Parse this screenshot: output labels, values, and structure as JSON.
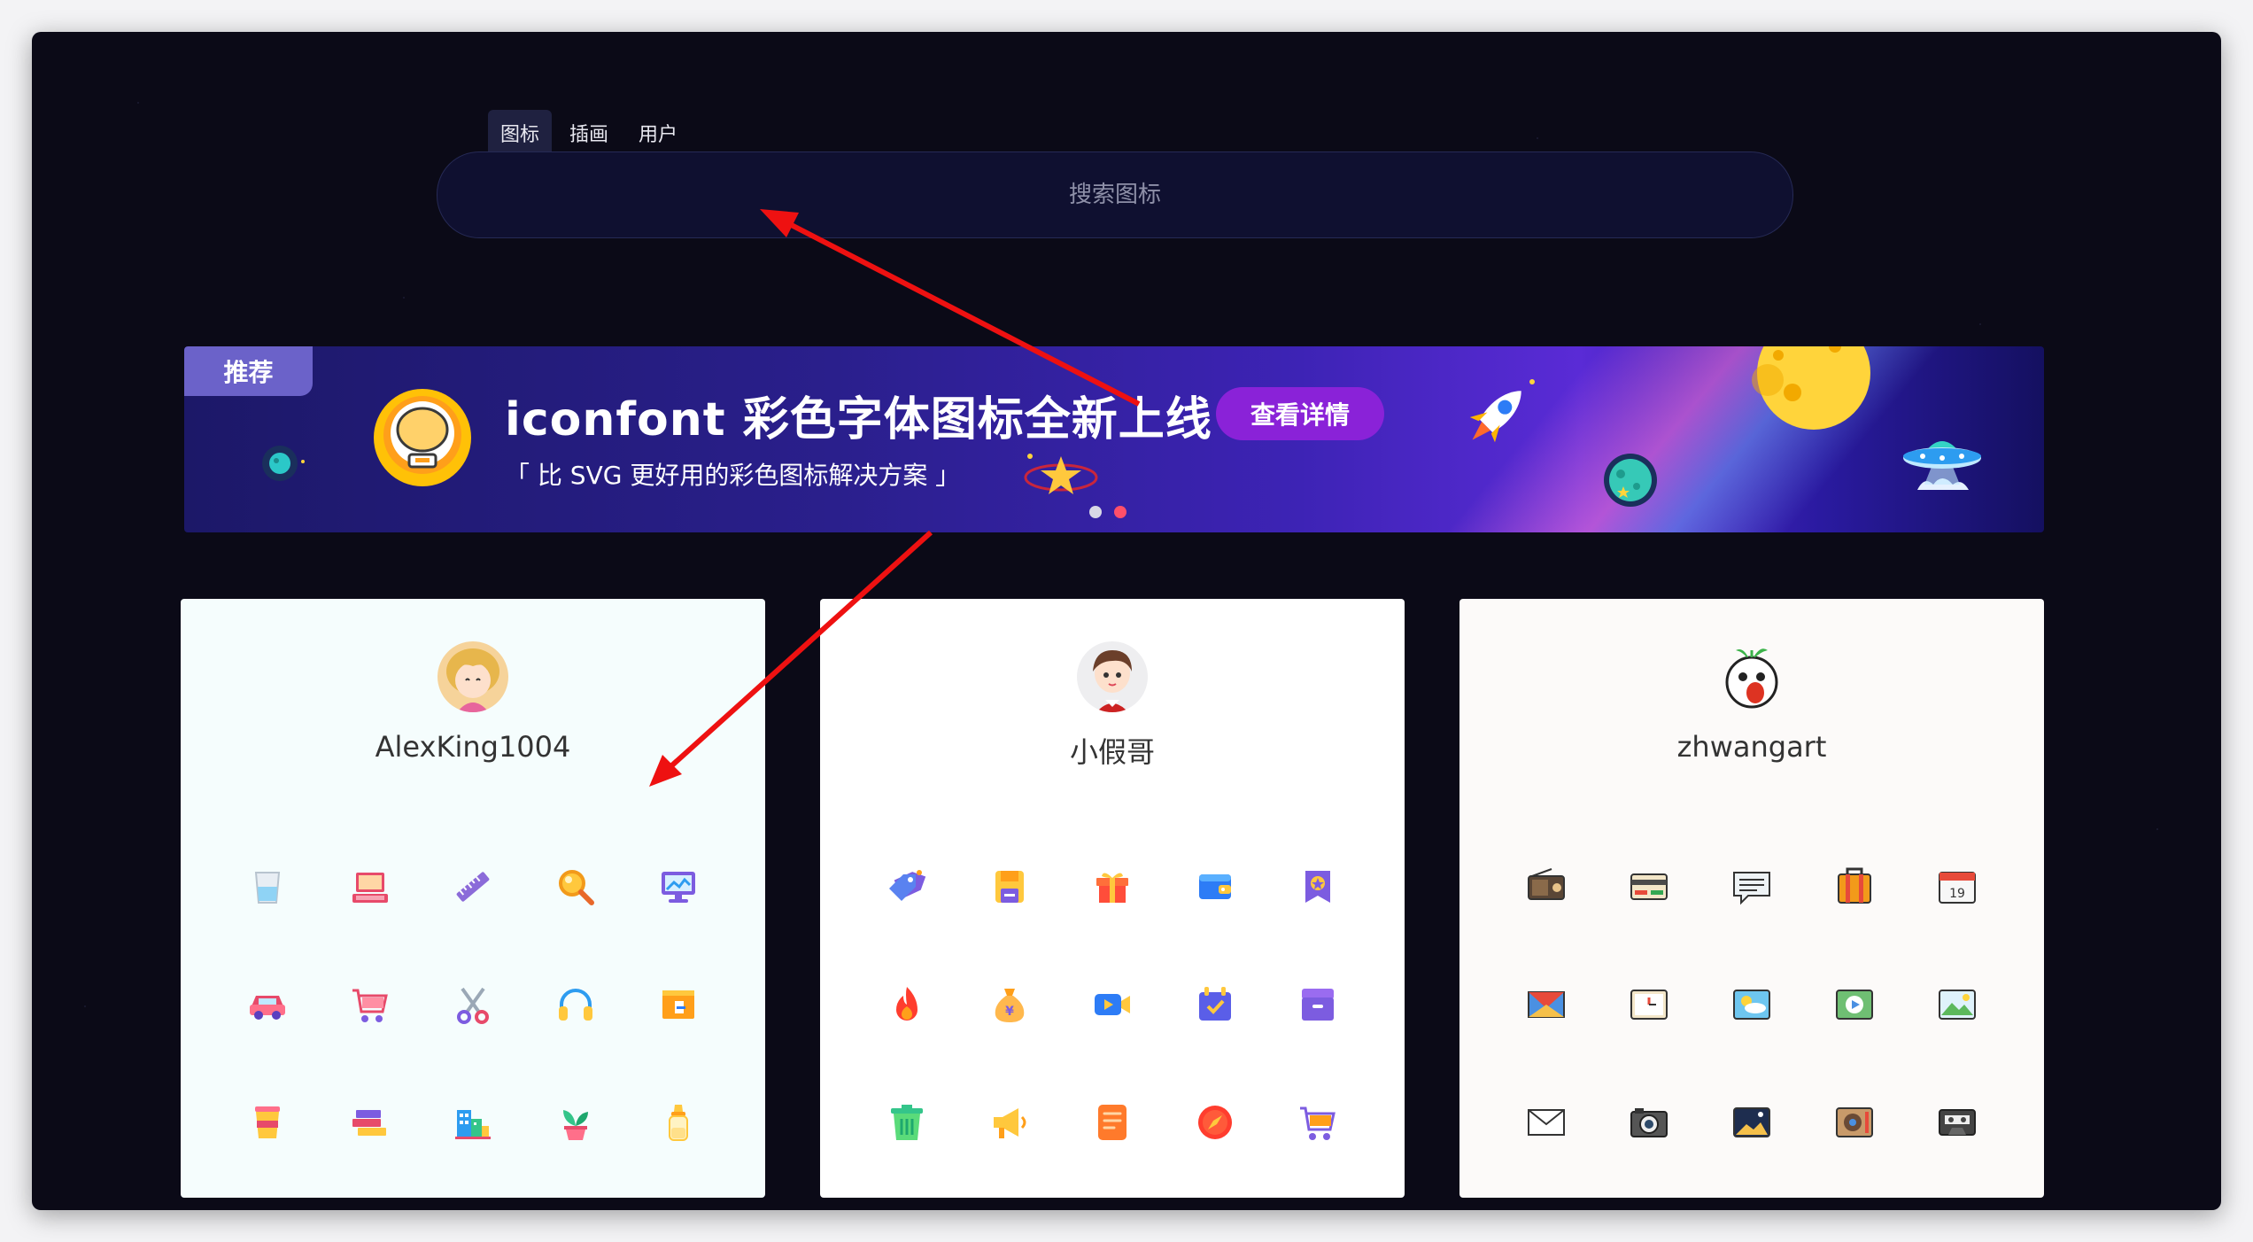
{
  "tabs": [
    {
      "label": "图标",
      "active": true
    },
    {
      "label": "插画",
      "active": false
    },
    {
      "label": "用户",
      "active": false
    }
  ],
  "search": {
    "placeholder": "搜索图标"
  },
  "banner": {
    "tag": "推荐",
    "title": "iconfont 彩色字体图标全新上线",
    "subtitle": "「 比 SVG 更好用的彩色图标解决方案 」",
    "button": "查看详情",
    "dots": 2,
    "active_dot": 1
  },
  "colors": {
    "page_bg": "#0b0a17",
    "accent": "#8a22d8",
    "annotation_arrow": "#ee1111"
  },
  "cards": [
    {
      "username": "AlexKing1004",
      "background": "#f5fdfd",
      "avatar_icon": "girl-avatar-icon",
      "icons": [
        "glass-cup-icon",
        "laptop-icon",
        "ruler-icon",
        "magnifier-icon",
        "monitor-icon",
        "car-icon",
        "shopping-cart-icon",
        "scissors-icon",
        "headphones-icon",
        "drawer-box-icon",
        "coffee-cup-icon",
        "books-icon",
        "city-buildings-icon",
        "potted-plant-icon",
        "baby-bottle-icon"
      ]
    },
    {
      "username": "小假哥",
      "background": "#ffffff",
      "avatar_icon": "boy-avatar-icon",
      "icons": [
        "price-tag-icon",
        "save-disk-icon",
        "gift-icon",
        "wallet-icon",
        "badge-bookmark-icon",
        "fire-icon",
        "money-bag-icon",
        "video-camera-icon",
        "calendar-check-icon",
        "inbox-icon",
        "trash-bin-icon",
        "megaphone-icon",
        "document-icon",
        "compass-icon",
        "cart-icon"
      ]
    },
    {
      "username": "zhwangart",
      "background": "#fcfaf9",
      "avatar_icon": "meme-face-avatar-icon",
      "icons": [
        "radio-icon",
        "credit-card-icon",
        "chat-bubble-icon",
        "suitcase-icon",
        "calendar-19-icon",
        "mail-envelope-icon",
        "clock-icon",
        "weather-cloud-icon",
        "media-player-icon",
        "landscape-photo-icon",
        "letter-icon",
        "camera-icon",
        "night-scene-icon",
        "speaker-icon",
        "cassette-icon"
      ]
    }
  ],
  "calendar_day": "19"
}
